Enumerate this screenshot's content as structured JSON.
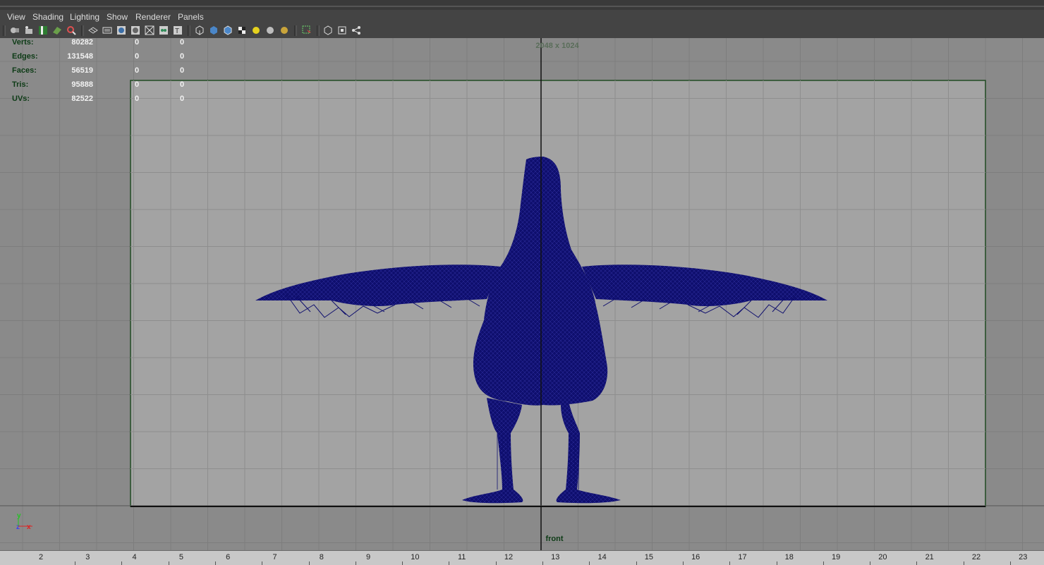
{
  "menu": {
    "items": [
      "View",
      "Shading",
      "Lighting",
      "Show",
      "Renderer",
      "Panels"
    ]
  },
  "toolbar": {
    "icons": [
      "select-camera-icon",
      "lock-camera-icon",
      "bookmarks-icon",
      "image-plane-icon",
      "2d-pan-zoom-icon",
      "grid-icon",
      "film-gate-icon",
      "resolution-gate-icon",
      "gate-mask-icon",
      "field-chart-icon",
      "safe-action-icon",
      "wireframe-icon",
      "smooth-shade-icon",
      "wireframe-on-shaded-icon",
      "textured-icon",
      "use-all-lights-icon",
      "shadows-icon",
      "high-quality-icon",
      "xray-select-icon",
      "isolate-select-icon",
      "frame-all-icon",
      "hierarchy-icon"
    ]
  },
  "hud": {
    "stats": [
      {
        "label": "Verts:",
        "value": "80282",
        "sel": "0",
        "sel2": "0"
      },
      {
        "label": "Edges:",
        "value": "131548",
        "sel": "0",
        "sel2": "0"
      },
      {
        "label": "Faces:",
        "value": "56519",
        "sel": "0",
        "sel2": "0"
      },
      {
        "label": "Tris:",
        "value": "95888",
        "sel": "0",
        "sel2": "0"
      },
      {
        "label": "UVs:",
        "value": "82522",
        "sel": "0",
        "sel2": "0"
      }
    ],
    "resolution": "2048 x 1024",
    "camera": "front"
  },
  "axis": {
    "y": "y",
    "z": "z",
    "x": "x"
  },
  "ruler": {
    "labels": [
      "2",
      "3",
      "4",
      "5",
      "6",
      "7",
      "8",
      "9",
      "10",
      "11",
      "12",
      "13",
      "14",
      "15",
      "16",
      "17",
      "18",
      "19",
      "20",
      "21",
      "22",
      "23"
    ]
  },
  "colors": {
    "viewport_bg": "#8a8a8a",
    "gate_bg": "#a3a3a3",
    "grid": "#7b7b7b",
    "gate_border": "#1f4a22",
    "wireframe": "#0f0f6e",
    "hud_label": "#0d3b16",
    "hud_value": "#f2f2f2"
  }
}
